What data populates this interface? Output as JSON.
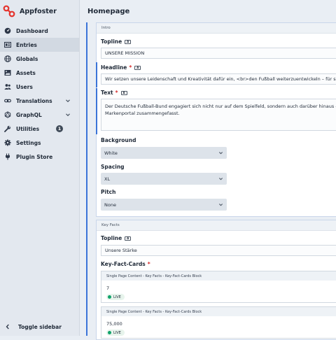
{
  "app": {
    "name": "Appfoster",
    "brand_color": "#e5342e"
  },
  "nav": {
    "items": [
      {
        "label": "Dashboard",
        "icon": "dashboard-icon"
      },
      {
        "label": "Entries",
        "icon": "entries-icon",
        "active": true
      },
      {
        "label": "Globals",
        "icon": "globe-icon"
      },
      {
        "label": "Assets",
        "icon": "image-icon"
      },
      {
        "label": "Users",
        "icon": "users-icon"
      },
      {
        "label": "Translations",
        "icon": "link-icon",
        "chevron": true
      },
      {
        "label": "GraphQL",
        "icon": "graphql-icon",
        "chevron": true
      },
      {
        "label": "Utilities",
        "icon": "wrench-icon",
        "badge": "1"
      },
      {
        "label": "Settings",
        "icon": "gear-icon"
      },
      {
        "label": "Plugin Store",
        "icon": "plug-icon"
      }
    ],
    "toggle_label": "Toggle sidebar"
  },
  "page": {
    "title": "Homepage"
  },
  "intro": {
    "section_label": "Intro",
    "topline_label": "Topline",
    "topline_value": "UNSERE MISSION",
    "headline_label": "Headline",
    "headline_value": "Wir setzen unsere Leidenschaft und Kreativität dafür ein, <br>den Fußball weiterzuentwickeln – für sp",
    "text_label": "Text",
    "text_value_line1": "Der Deutsche Fußball-Bund engagiert sich nicht nur auf dem Spielfeld, sondern auch darüber hinaus –",
    "text_value_line2": "Markenportal zusammengefasst.",
    "background_label": "Background",
    "background_value": "White",
    "spacing_label": "Spacing",
    "spacing_value": "XL",
    "pitch_label": "Pitch",
    "pitch_value": "None"
  },
  "key_facts": {
    "section_label": "Key Facts",
    "topline_label": "Topline",
    "topline_value": "Unsere Stärke",
    "cards_label": "Key-Fact-Cards",
    "blocks": [
      {
        "title": "Single Page Content - Key Facts - Key-Fact-Cards Block",
        "value": "7",
        "status": "LIVE"
      },
      {
        "title": "Single Page Content - Key Facts - Key-Fact-Cards Block",
        "value": "75,000",
        "status": "LIVE"
      }
    ]
  },
  "colors": {
    "accent": "#3b74d8",
    "required": "#d62c2c",
    "live": "#10a26a"
  }
}
